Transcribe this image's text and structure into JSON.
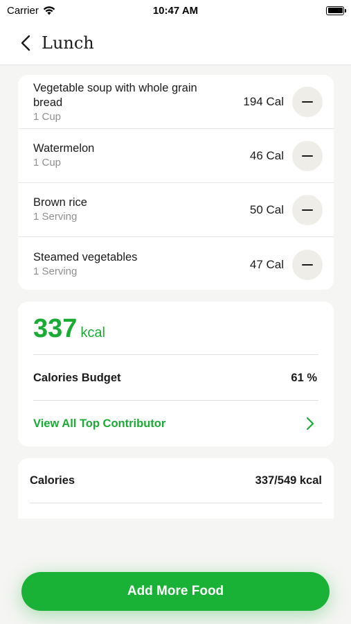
{
  "status_bar": {
    "carrier": "Carrier",
    "time": "10:47 AM"
  },
  "nav": {
    "title": "Lunch"
  },
  "food_items": [
    {
      "name": "Vegetable soup with whole grain bread",
      "portion": "1 Cup",
      "calories": "194 Cal"
    },
    {
      "name": "Watermelon",
      "portion": "1 Cup",
      "calories": "46 Cal"
    },
    {
      "name": "Brown rice",
      "portion": "1 Serving",
      "calories": "50 Cal"
    },
    {
      "name": "Steamed vegetables",
      "portion": "1 Serving",
      "calories": "47 Cal"
    }
  ],
  "summary": {
    "kcal_value": "337",
    "kcal_unit": "kcal",
    "budget_label": "Calories Budget",
    "budget_value": "61 %",
    "contributor_link": "View All Top Contributor"
  },
  "calories_card": {
    "label": "Calories",
    "value": "337/549 kcal"
  },
  "add_button": {
    "label": "Add More Food"
  },
  "colors": {
    "accent": "#1aab34",
    "button": "#19b236",
    "minus_bg": "#efede8"
  }
}
